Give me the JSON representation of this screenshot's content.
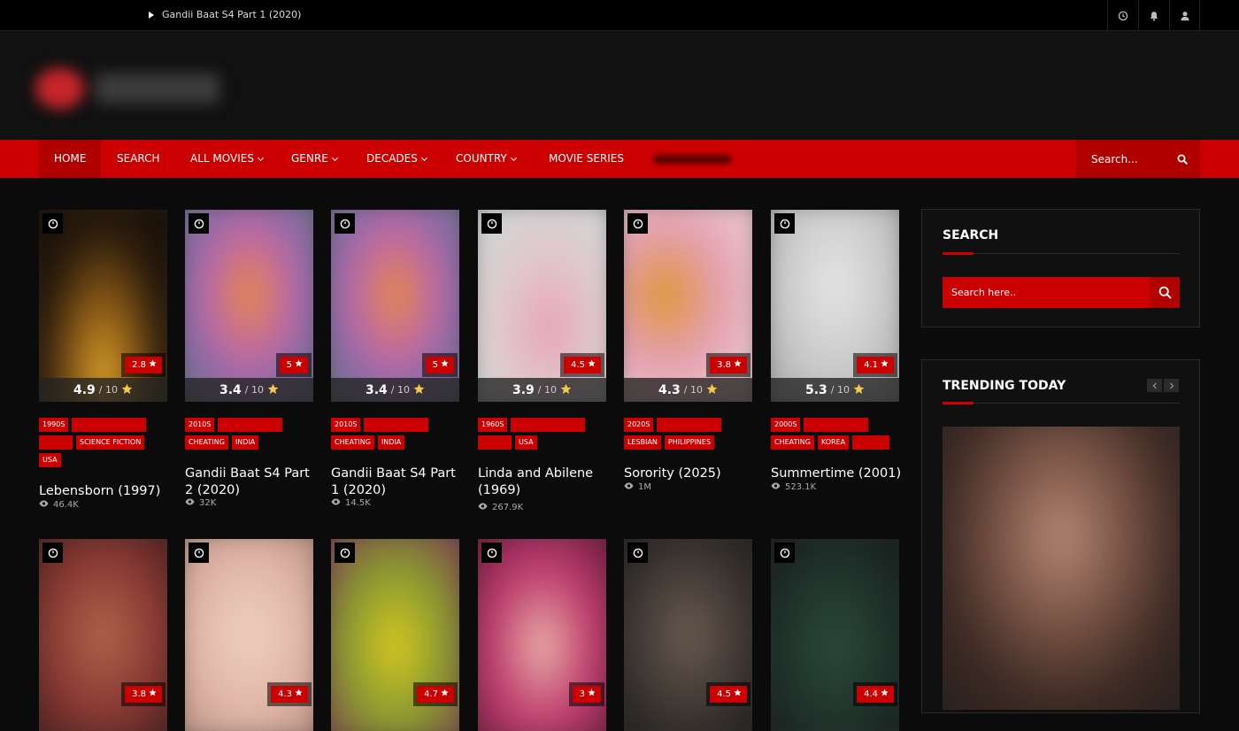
{
  "topbar": {
    "ticker_text": "Gandii Baat S4 Part 1 (2020)",
    "icons": [
      "clock-icon",
      "bell-icon",
      "user-icon"
    ]
  },
  "nav": {
    "items": [
      "HOME",
      "SEARCH",
      "ALL MOVIES",
      "GENRE",
      "DECADES",
      "COUNTRY",
      "MOVIE SERIES"
    ],
    "dropdown_items": [
      "ALL MOVIES",
      "GENRE",
      "DECADES",
      "COUNTRY"
    ],
    "search_placeholder": "Search..."
  },
  "movies": [
    {
      "title": "Lebensborn (1997)",
      "rating_badge": "2.8",
      "rating": "4.9",
      "rating_max": "/ 10",
      "tags": [
        "1990S",
        "",
        "",
        "SCIENCE FICTION",
        "USA"
      ],
      "views": "46.4K"
    },
    {
      "title": "Gandii Baat S4 Part 2 (2020)",
      "rating_badge": "5",
      "rating": "3.4",
      "rating_max": "/ 10",
      "tags": [
        "2010S",
        "",
        "CHEATING",
        "INDIA"
      ],
      "views": "32K"
    },
    {
      "title": "Gandii Baat S4 Part 1 (2020)",
      "rating_badge": "5",
      "rating": "3.4",
      "rating_max": "/ 10",
      "tags": [
        "2010S",
        "",
        "CHEATING",
        "INDIA"
      ],
      "views": "14.5K"
    },
    {
      "title": "Linda and Abilene (1969)",
      "rating_badge": "4.5",
      "rating": "3.9",
      "rating_max": "/ 10",
      "tags": [
        "1960S",
        "",
        "",
        "USA"
      ],
      "views": "267.9K"
    },
    {
      "title": "Sorority (2025)",
      "rating_badge": "3.8",
      "rating": "4.3",
      "rating_max": "/ 10",
      "tags": [
        "2020S",
        "",
        "LESBIAN",
        "PHILIPPINES"
      ],
      "views": "1M"
    },
    {
      "title": "Summertime (2001)",
      "rating_badge": "4.1",
      "rating": "5.3",
      "rating_max": "/ 10",
      "tags": [
        "2000S",
        "",
        "CHEATING",
        "KOREA",
        ""
      ],
      "views": "523.1K"
    }
  ],
  "movies_row2": [
    {
      "rating_badge": "3.8"
    },
    {
      "rating_badge": "4.3"
    },
    {
      "rating_badge": "4.7"
    },
    {
      "rating_badge": "3"
    },
    {
      "rating_badge": "4.5"
    },
    {
      "rating_badge": "4.4"
    }
  ],
  "sidebar": {
    "search_title": "SEARCH",
    "search_placeholder": "Search here..",
    "trending_title": "TRENDING TODAY"
  },
  "colors": {
    "accent": "#cc0000",
    "accent_dark": "#b00000",
    "background": "#0b0b0b",
    "star": "#f2c94c"
  }
}
